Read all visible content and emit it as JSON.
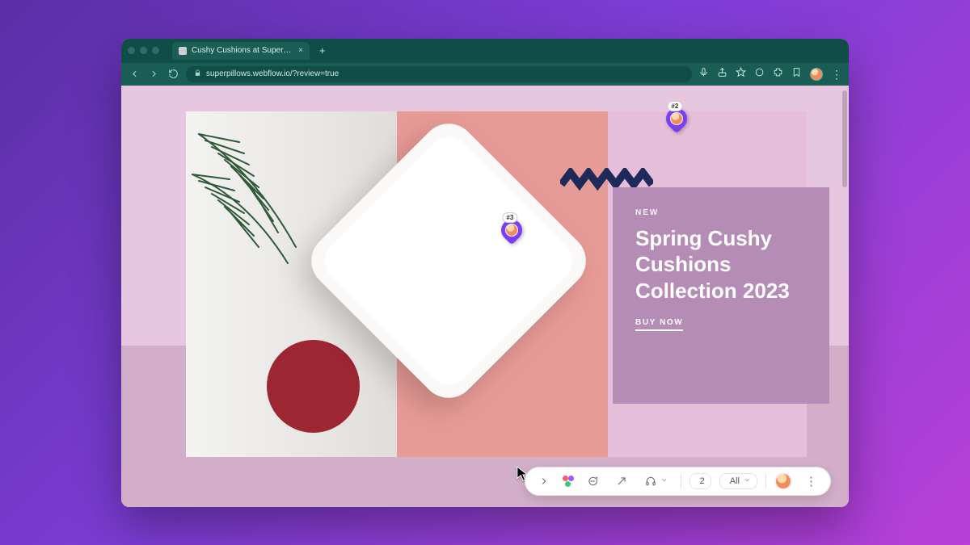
{
  "browser": {
    "tab_title": "Cushy Cushions at Superpillo…",
    "url": "superpillows.webflow.io/?review=true"
  },
  "hero": {
    "eyebrow": "NEW",
    "headline": "Spring Cushy Cushions Collection 2023",
    "cta": "BUY NOW"
  },
  "pins": {
    "p2": "#2",
    "p3": "#3"
  },
  "toolbar": {
    "inbox_count": "2",
    "visibility_label": "All"
  }
}
